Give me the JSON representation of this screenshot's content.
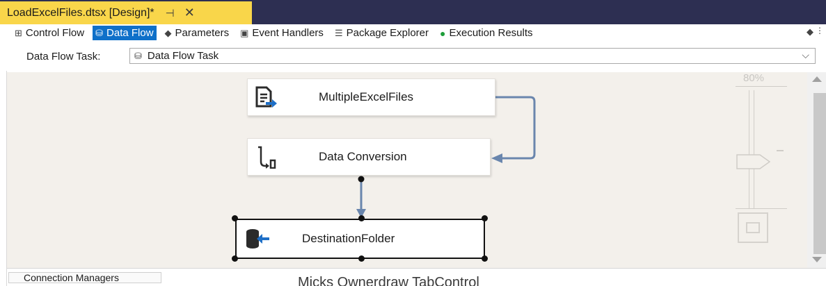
{
  "document_tab": {
    "title": "LoadExcelFiles.dtsx [Design]*",
    "pin_icon": "pin-icon",
    "close_icon": "close-icon"
  },
  "designer_tabs": [
    {
      "label": "Control Flow",
      "icon": "control-flow-icon",
      "active": false
    },
    {
      "label": "Data Flow",
      "icon": "data-flow-icon",
      "active": true
    },
    {
      "label": "Parameters",
      "icon": "parameters-icon",
      "active": false
    },
    {
      "label": "Event Handlers",
      "icon": "event-handlers-icon",
      "active": false
    },
    {
      "label": "Package Explorer",
      "icon": "package-explorer-icon",
      "active": false
    },
    {
      "label": "Execution Results",
      "icon": "execution-results-icon",
      "active": false
    }
  ],
  "task_selector": {
    "label": "Data Flow Task:",
    "value": "Data Flow Task"
  },
  "components": {
    "source": {
      "label": "MultipleExcelFiles"
    },
    "conversion": {
      "label": "Data Conversion"
    },
    "destination": {
      "label": "DestinationFolder"
    }
  },
  "zoom": {
    "label": "80%"
  },
  "bottom": {
    "connection_managers": "Connection Managers",
    "control_caption": "Micks Ownerdraw TabControl"
  },
  "colors": {
    "tab_bar": "#2d2f52",
    "doc_tab": "#f9d64a",
    "active_tab": "#0e70c9",
    "canvas": "#f3f0eb",
    "connector": "#6a86ad"
  }
}
